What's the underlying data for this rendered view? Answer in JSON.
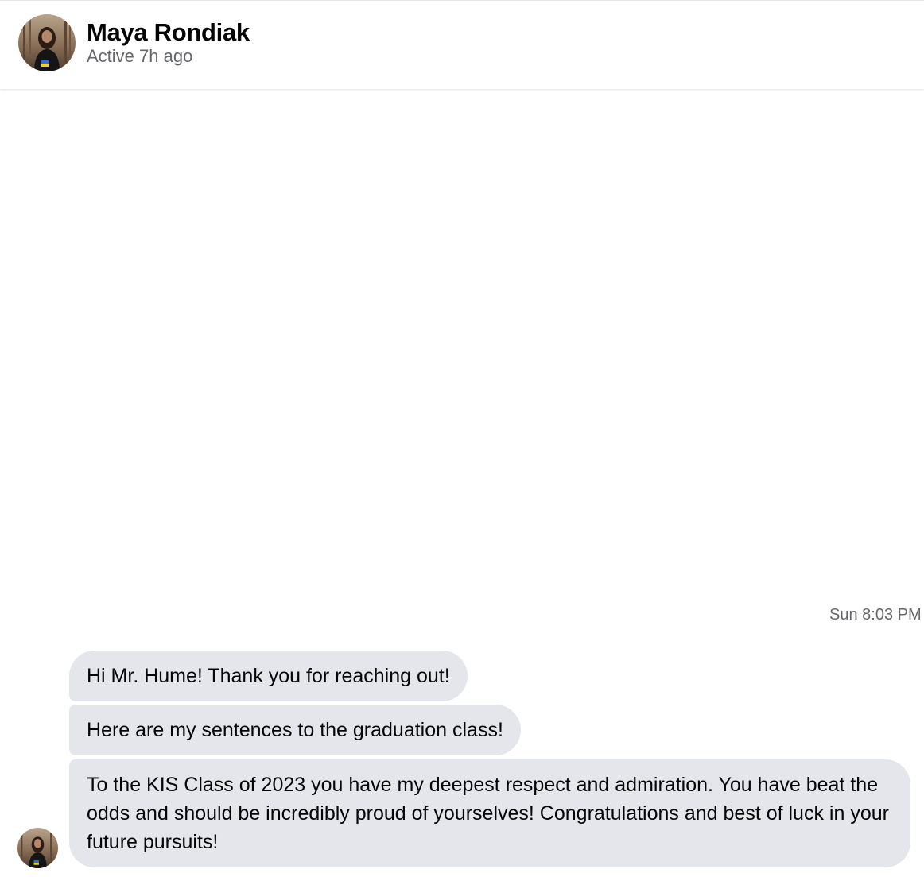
{
  "header": {
    "contact_name": "Maya Rondiak",
    "status": "Active 7h ago",
    "avatar_icon": "profile-photo-avatar"
  },
  "conversation": {
    "timestamp": "Sun 8:03 PM",
    "messages": [
      {
        "sender": "Maya Rondiak",
        "text": "Hi Mr. Hume! Thank you for reaching out!"
      },
      {
        "sender": "Maya Rondiak",
        "text": "Here are my sentences to the graduation class!"
      },
      {
        "sender": "Maya Rondiak",
        "text": "To the KIS Class of 2023 you have my deepest respect and admiration. You have beat the odds and should be incredibly proud of yourselves! Congratulations and best of luck in your future pursuits!"
      }
    ]
  },
  "colors": {
    "bubble_background": "#e4e6eb",
    "secondary_text": "#65676b",
    "primary_text": "#050505"
  }
}
